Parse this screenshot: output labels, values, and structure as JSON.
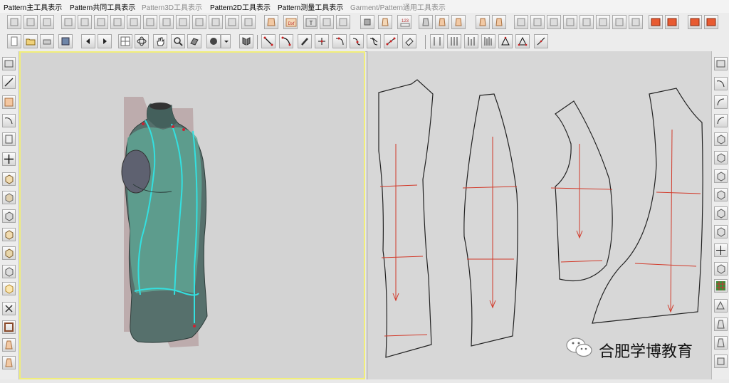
{
  "menubar": {
    "items": [
      {
        "label": "Pattern主工具表示",
        "enabled": true
      },
      {
        "label": "Pattern共同工具表示",
        "enabled": true
      },
      {
        "label": "Pattern3D工具表示",
        "enabled": false
      },
      {
        "label": "Pattern2D工具表示",
        "enabled": true
      },
      {
        "label": "Pattern测量工具表示",
        "enabled": true
      },
      {
        "label": "Garment/Pattern通用工具表示",
        "enabled": false
      }
    ]
  },
  "toolbar_icons": {
    "dxf": "Dxf",
    "tool_t": "T",
    "measure_123": "123"
  },
  "watermark": {
    "text": "合肥学博教育",
    "icon": "wechat-icon"
  },
  "colors": {
    "viewport_active_border": "#f1ee7a",
    "pattern_line": "#222222",
    "grainline": "#d23a2a",
    "seam_highlight": "#33e0e0"
  }
}
